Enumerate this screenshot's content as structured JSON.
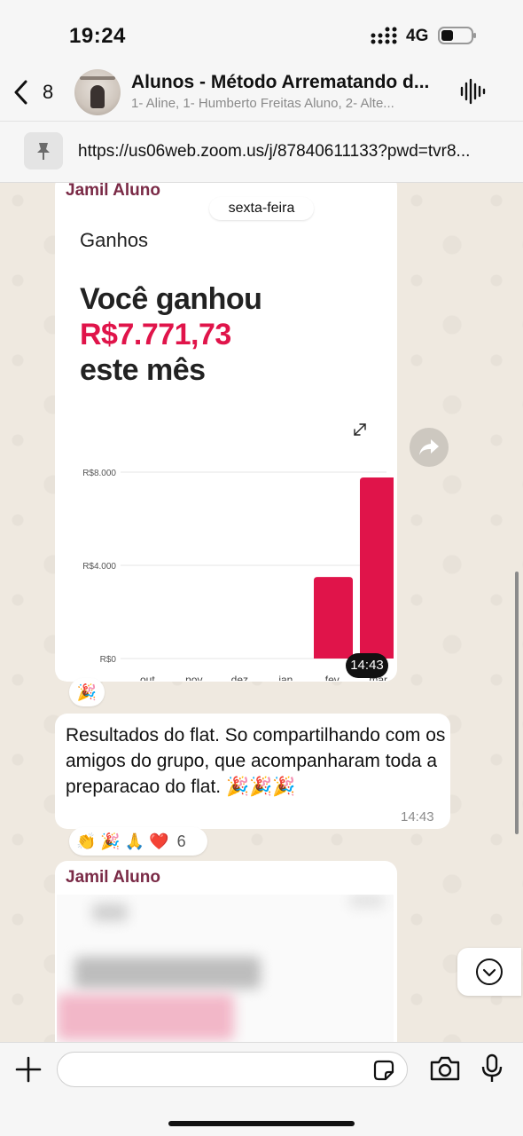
{
  "status_bar": {
    "time": "19:24",
    "network": "4G"
  },
  "header": {
    "back_count": "8",
    "title": "Alunos - Método Arrematando d...",
    "subtitle": "1- Aline, 1- Humberto Freitas Aluno, 2- Alte..."
  },
  "pinned": {
    "url": "https://us06web.zoom.us/j/87840611133?pwd=tvr8..."
  },
  "messages": [
    {
      "sender": "Jamil Aluno",
      "date_chip": "sexta-feira",
      "image": {
        "title": "Ganhos",
        "line1": "Você ganhou",
        "amount": "R$7.771,73",
        "line3": "este mês"
      },
      "time": "14:43",
      "reaction": "🎉"
    },
    {
      "text": "Resultados do flat. So compartilhando com os amigos do grupo, que acompanharam toda a preparacao do flat. 🎉🎉🎉",
      "time": "14:43",
      "reactions": "👏 🎉 🙏 ❤️",
      "reaction_count": "6"
    },
    {
      "sender": "Jamil Aluno"
    }
  ],
  "chart_data": {
    "type": "bar",
    "categories": [
      "out.",
      "nov.",
      "dez.",
      "jan.",
      "fev.",
      "mar."
    ],
    "values": [
      0,
      0,
      0,
      0,
      3500,
      7772
    ],
    "ylim": [
      0,
      8000
    ],
    "y_ticks": [
      "R$0",
      "R$4.000",
      "R$8.000"
    ],
    "y_tick_values": [
      0,
      4000,
      8000
    ],
    "bar_color": "#e0144a",
    "grid": true
  },
  "colors": {
    "accent": "#e0144a",
    "sender": "#7a2a46"
  }
}
